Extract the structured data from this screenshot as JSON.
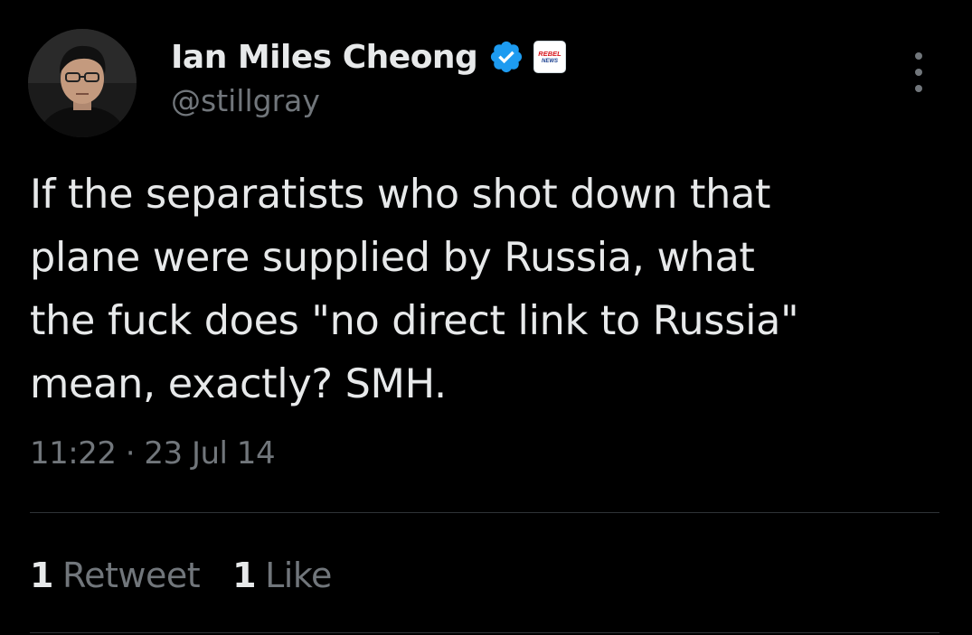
{
  "tweet": {
    "author": {
      "display_name": "Ian Miles Cheong",
      "handle": "@stillgray",
      "verified_icon": "verified-badge-icon",
      "affiliate_badge_text": "REBEL NEWS"
    },
    "text": "If the separatists who shot down that\nplane were supplied by Russia, what\nthe fuck does \"no direct link to Russia\"\nmean, exactly? SMH.",
    "timestamp": "11:22 · 23 Jul 14",
    "stats": {
      "retweets_count": "1",
      "retweets_label": "Retweet",
      "likes_count": "1",
      "likes_label": "Like"
    }
  },
  "colors": {
    "background": "#000000",
    "text_primary": "#e7e9ea",
    "text_secondary": "#71767b",
    "verified_blue": "#1d9bf0",
    "divider": "#2f3336",
    "affiliate_red": "#d7141a"
  },
  "icons": {
    "more": "more-options-icon",
    "verified": "verified-badge-icon",
    "affiliate": "affiliate-logo-icon"
  }
}
